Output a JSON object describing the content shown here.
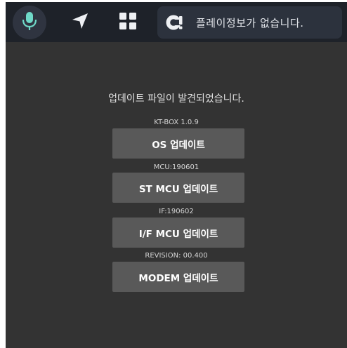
{
  "topbar": {
    "icons": {
      "mic": "microphone-icon",
      "navigation": "navigation-arrow-icon",
      "apps": "apps-grid-icon",
      "media": "media-source-icon"
    },
    "media_status": "플레이정보가 없습니다."
  },
  "update_panel": {
    "message": "업데이트 파일이 발견되었습니다.",
    "items": [
      {
        "version": "KT-BOX 1.0.9",
        "button_label": "OS 업데이트"
      },
      {
        "version": "MCU:190601",
        "button_label": "ST MCU 업데이트"
      },
      {
        "version": "IF:190602",
        "button_label": "I/F MCU 업데이트"
      },
      {
        "version": "REVISION: 00.400",
        "button_label": "MODEM 업데이트"
      }
    ]
  },
  "colors": {
    "screen_background": "#333333",
    "topbar_background": "#1e2229",
    "mic_accent": "#6fd9c8",
    "button_background": "#595959",
    "text": "#ffffff"
  }
}
